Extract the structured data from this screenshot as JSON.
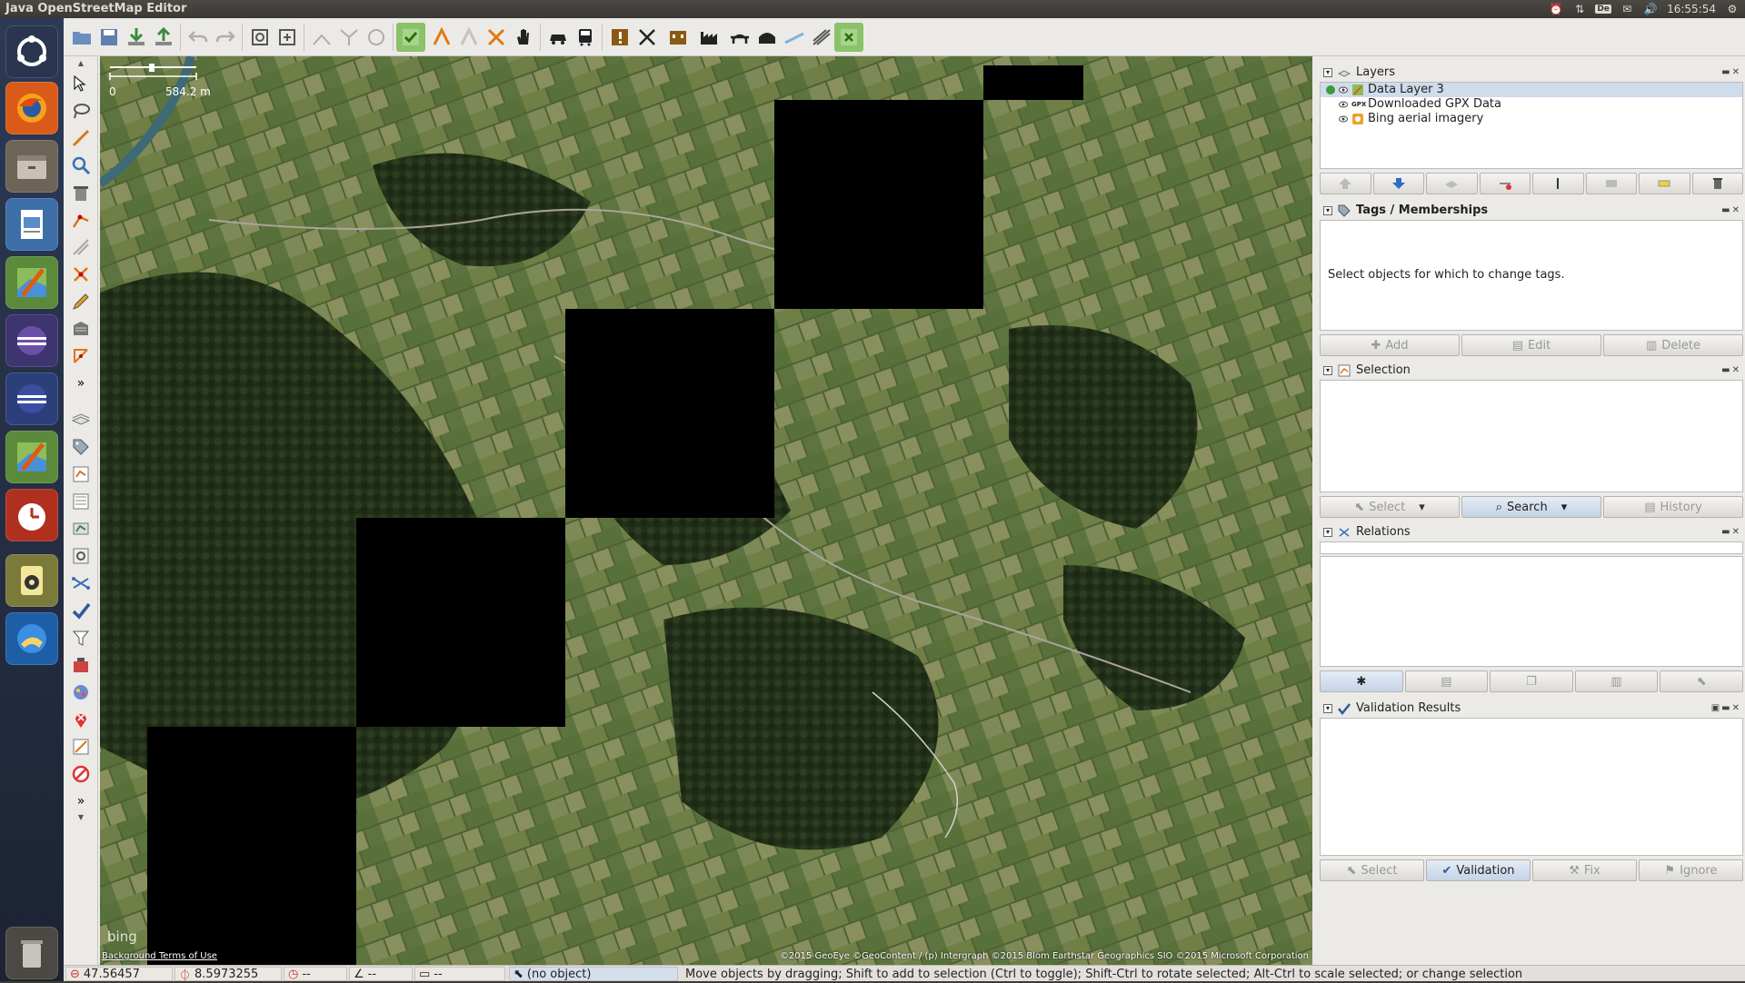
{
  "window": {
    "title": "Java OpenStreetMap Editor"
  },
  "tray": {
    "keyboard": "De",
    "clock": "16:55:54"
  },
  "map": {
    "scale_start": "0",
    "scale_end": "584.2 m",
    "bing_logo": "bing",
    "terms_link": "Background Terms of Use",
    "attribution": "©2015 GeoEye ©GeoContent / (p) Intergraph ©2015 Blom Earthstar Geographics  SIO ©2015 Microsoft Corporation"
  },
  "layers_panel": {
    "title": "Layers",
    "items": [
      {
        "name": "Data Layer 3",
        "icon": "osm-data-layer-icon"
      },
      {
        "name": "Downloaded GPX Data",
        "icon": "gpx-layer-icon",
        "badge": "GPX"
      },
      {
        "name": "Bing aerial imagery",
        "icon": "imagery-layer-icon"
      }
    ]
  },
  "tags_panel": {
    "title": "Tags / Memberships",
    "message": "Select objects for which to change tags.",
    "add_label": "Add",
    "edit_label": "Edit",
    "delete_label": "Delete"
  },
  "selection_panel": {
    "title": "Selection",
    "select_label": "Select",
    "search_label": "Search",
    "history_label": "History"
  },
  "relations_panel": {
    "title": "Relations"
  },
  "validation_panel": {
    "title": "Validation Results",
    "select_label": "Select",
    "validation_label": "Validation",
    "fix_label": "Fix",
    "ignore_label": "Ignore"
  },
  "status": {
    "lat": "47.56457",
    "lon": "8.5973255",
    "heading": "--",
    "angle": "--",
    "length": "--",
    "object": "(no object)",
    "help": "Move objects by dragging; Shift to add to selection (Ctrl to toggle); Shift-Ctrl to rotate selected; Alt-Ctrl to scale selected; or change selection"
  },
  "colors": {
    "accent": "#3b6fb6",
    "map_black": "#000000",
    "launcher_bg": "#2c3a55"
  }
}
